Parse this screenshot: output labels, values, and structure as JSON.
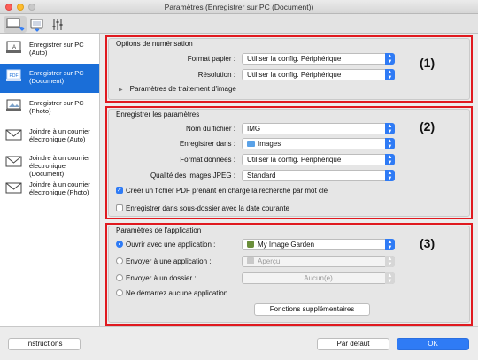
{
  "window": {
    "title": "Paramètres (Enregistrer sur PC (Document))"
  },
  "toolbar": {
    "tabs": [
      "scan-from-computer-icon",
      "scan-from-operation-panel-icon",
      "general-settings-icon"
    ]
  },
  "sidebar": {
    "items": [
      {
        "label": "Enregistrer sur PC (Auto)",
        "icon": "save-pc-auto-icon",
        "selected": false
      },
      {
        "label": "Enregistrer sur PC (Document)",
        "icon": "save-pc-document-icon",
        "selected": true
      },
      {
        "label": "Enregistrer sur PC (Photo)",
        "icon": "save-pc-photo-icon",
        "selected": false
      },
      {
        "label": "Joindre à un courrier électronique (Auto)",
        "icon": "email-auto-icon",
        "selected": false
      },
      {
        "label": "Joindre à un courrier électronique (Document)",
        "icon": "email-document-icon",
        "selected": false
      },
      {
        "label": "Joindre à un courrier électronique (Photo)",
        "icon": "email-photo-icon",
        "selected": false
      }
    ]
  },
  "scan_options": {
    "title": "Options de numérisation",
    "paper_size_label": "Format papier :",
    "paper_size_value": "Utiliser la config. Périphérique",
    "resolution_label": "Résolution :",
    "resolution_value": "Utiliser la config. Périphérique",
    "image_processing_label": "Paramètres de traitement d'image",
    "marker": "(1)"
  },
  "save_settings": {
    "title": "Enregistrer les paramètres",
    "filename_label": "Nom du fichier :",
    "filename_value": "IMG",
    "save_in_label": "Enregistrer dans :",
    "save_in_value": "Images",
    "data_format_label": "Format données :",
    "data_format_value": "Utiliser la config. Périphérique",
    "jpeg_quality_label": "Qualité des images JPEG :",
    "jpeg_quality_value": "Standard",
    "searchable_pdf_label": "Créer un fichier PDF prenant en charge la recherche par mot clé",
    "searchable_pdf_checked": true,
    "subfolder_label": "Enregistrer dans sous-dossier avec la date courante",
    "subfolder_checked": false,
    "marker": "(2)"
  },
  "app_settings": {
    "title": "Paramètres de l'application",
    "open_app_label": "Ouvrir avec une application :",
    "open_app_value": "My Image Garden",
    "send_app_label": "Envoyer à une application :",
    "send_app_value": "Aperçu",
    "send_folder_label": "Envoyer à un dossier :",
    "send_folder_value": "Aucun(e)",
    "no_app_label": "Ne démarrez aucune application",
    "more_functions_label": "Fonctions supplémentaires",
    "marker": "(3)"
  },
  "footer": {
    "instructions_label": "Instructions",
    "default_label": "Par défaut",
    "ok_label": "OK"
  },
  "colors": {
    "accent": "#2f7bf5",
    "selection": "#1a6ed8",
    "highlight_frame": "#e0191f"
  }
}
